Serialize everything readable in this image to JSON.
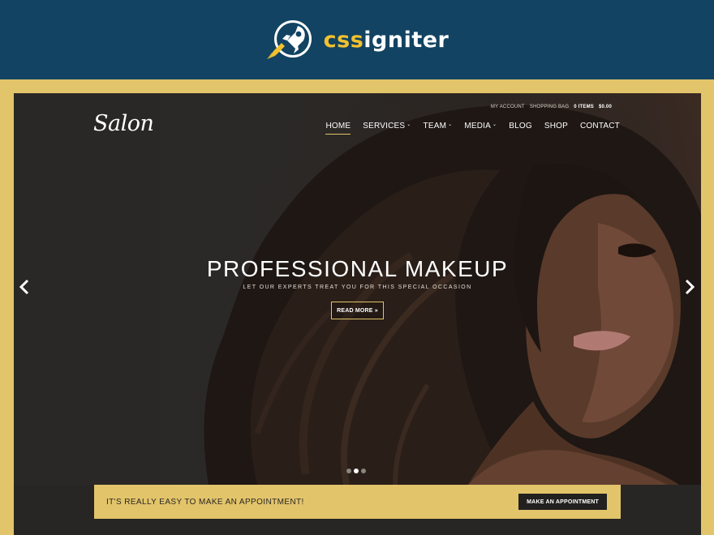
{
  "brand": {
    "name_prefix": "css",
    "name_suffix": "igniter",
    "icon": "rocket-icon",
    "colors": {
      "bar": "#124362",
      "accent": "#f2c12e",
      "frame": "#e2c46a"
    }
  },
  "site": {
    "logo_text": "Salon",
    "utility": {
      "my_account": "MY ACCOUNT",
      "shopping_bag": "SHOPPING BAG",
      "items": "0 ITEMS",
      "total": "$0.00"
    },
    "nav": {
      "home": "HOME",
      "services": "SERVICES",
      "team": "TEAM",
      "media": "MEDIA",
      "blog": "BLOG",
      "shop": "SHOP",
      "contact": "CONTACT"
    }
  },
  "slider": {
    "headline": "PROFESSIONAL MAKEUP",
    "subline": "LET OUR EXPERTS TREAT YOU FOR THIS SPECIAL OCCASION",
    "button": "READ MORE »",
    "dots_total": 3,
    "active_dot": 2
  },
  "appointment": {
    "text": "IT'S REALLY EASY TO MAKE AN APPOINTMENT!",
    "button": "MAKE AN APPOINTMENT"
  }
}
